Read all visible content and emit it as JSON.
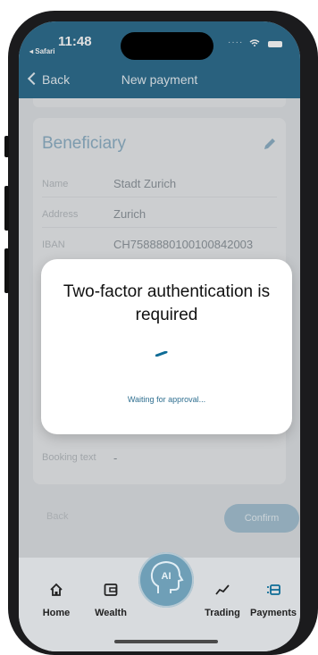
{
  "status_bar": {
    "time": "11:48",
    "back_app": "Safari"
  },
  "nav": {
    "back_label": "Back",
    "title": "New payment"
  },
  "beneficiary": {
    "title": "Beneficiary",
    "rows": [
      {
        "label": "Name",
        "value": "Stadt Zurich"
      },
      {
        "label": "Address",
        "value": "Zurich"
      },
      {
        "label": "IBAN",
        "value": "CH7588880100100842003"
      },
      {
        "label": "Booking text",
        "value": "-"
      }
    ]
  },
  "actions": {
    "back_label": "Back",
    "confirm_label": "Confirm"
  },
  "modal": {
    "title": "Two-factor authentication is required",
    "status": "Waiting for approval..."
  },
  "tabs": [
    {
      "label": "Home",
      "icon": "home-icon"
    },
    {
      "label": "Wealth",
      "icon": "wallet-icon"
    },
    {
      "label": "AI",
      "icon": "ai-head-icon"
    },
    {
      "label": "Trading",
      "icon": "trend-icon"
    },
    {
      "label": "Payments",
      "icon": "payments-icon"
    }
  ],
  "colors": {
    "brand": "#2f6f90",
    "accent": "#0e6c96"
  }
}
